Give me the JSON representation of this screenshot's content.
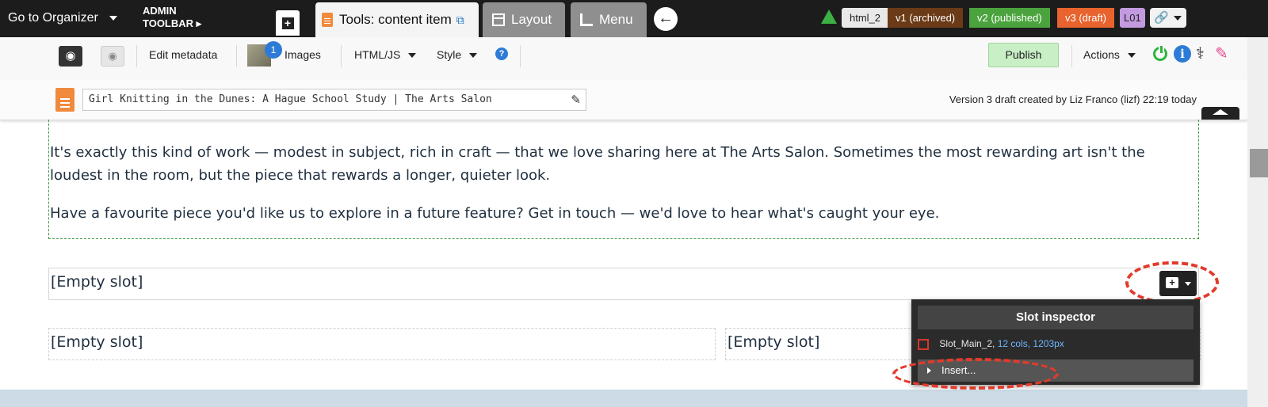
{
  "topbar": {
    "organizer_label": "Go to Organizer",
    "admin_toolbar": [
      "ADMIN",
      "TOOLBAR ▸"
    ],
    "tabs": [
      {
        "label": "Tools: content item",
        "icon": "document-icon",
        "active": true
      },
      {
        "label": "Layout",
        "icon": "layout-icon",
        "active": false
      },
      {
        "label": "Menu",
        "icon": "menu-icon",
        "active": false
      }
    ],
    "back_icon": "←",
    "versions": [
      {
        "label": "html_2",
        "color": "#e9e9e9"
      },
      {
        "label": "v1 (archived)",
        "color": "#6b3a16"
      },
      {
        "label": "v2 (published)",
        "color": "#4aa33c"
      },
      {
        "label": "v3 (draft)",
        "color": "#e8632d"
      }
    ],
    "layout_code": "L01"
  },
  "toolbar": {
    "edit_metadata": "Edit metadata",
    "images_label": "Images",
    "images_count": "1",
    "htmljs_label": "HTML/JS",
    "style_label": "Style",
    "help_label": "?",
    "publish_label": "Publish",
    "actions_label": "Actions"
  },
  "titlebar": {
    "page_title": "Girl Knitting in the Dunes: A Hague School Study | The Arts Salon",
    "version_info": "Version 3 draft created by Liz Franco (lizf) 22:19 today"
  },
  "content": {
    "paragraphs": [
      "It's exactly this kind of work — modest in subject, rich in craft — that we love sharing here at The Arts Salon. Sometimes the most rewarding art isn't the loudest in the room, but the piece that rewards a longer, quieter look.",
      "Have a favourite piece you'd like us to explore in a future feature? Get in touch — we'd love to hear what's caught your eye."
    ],
    "slots": [
      "[Empty slot]",
      "[Empty slot]",
      "[Empty slot]"
    ]
  },
  "inspector": {
    "title": "Slot inspector",
    "slot_name": "Slot_Main_2,",
    "slot_meta": "12 cols, 1203px",
    "insert_label": "Insert..."
  },
  "colors": {
    "accent_orange": "#e8632d",
    "annotation_red": "#e23b2b",
    "publish_green": "#c9efc6"
  }
}
